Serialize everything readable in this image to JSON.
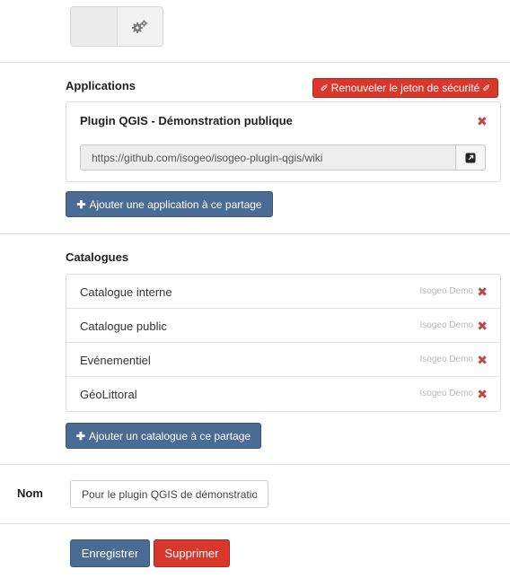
{
  "toolbar": {
    "settings_icon": "gears-icon"
  },
  "applications": {
    "title": "Applications",
    "renew_token_label": "Renouveler le jeton de sécurité",
    "items": [
      {
        "name": "Plugin QGIS - Démonstration publique",
        "url": "https://github.com/isogeo/isogeo-plugin-qgis/wiki"
      }
    ],
    "add_label": "Ajouter une application à ce partage"
  },
  "catalogs": {
    "title": "Catalogues",
    "items": [
      {
        "name": "Catalogue interne",
        "owner": "Isogeo Demo"
      },
      {
        "name": "Catalogue public",
        "owner": "Isogeo Demo"
      },
      {
        "name": "Evénementiel",
        "owner": "Isogeo Demo"
      },
      {
        "name": "GéoLittoral",
        "owner": "Isogeo Demo"
      }
    ],
    "add_label": "Ajouter un catalogue à ce partage"
  },
  "form": {
    "name_label": "Nom",
    "name_value": "Pour le plugin QGIS de démonstration"
  },
  "actions": {
    "save_label": "Enregistrer",
    "delete_label": "Supprimer"
  },
  "colors": {
    "primary": "#4a6b93",
    "danger": "#d9372b",
    "remove": "#b94a48"
  }
}
